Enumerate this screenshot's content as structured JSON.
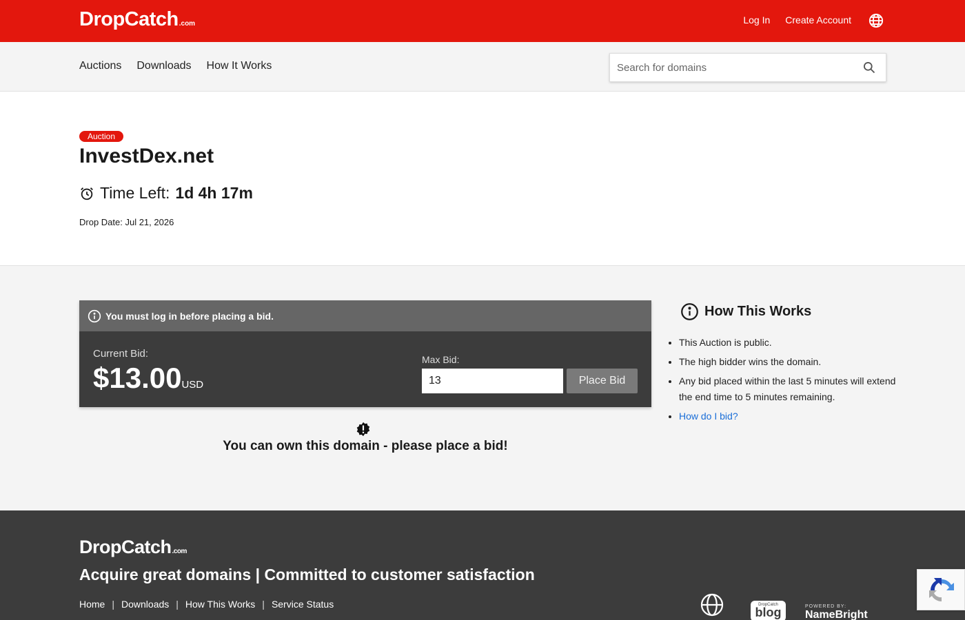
{
  "header": {
    "logo_text": "DropCatch",
    "logo_suffix": ".com",
    "login_label": "Log In",
    "create_account_label": "Create Account",
    "brand_color": "#e3170d"
  },
  "nav": {
    "items": [
      {
        "label": "Auctions"
      },
      {
        "label": "Downloads"
      },
      {
        "label": "How It Works"
      }
    ],
    "search_placeholder": "Search for domains"
  },
  "domain": {
    "badge": "Auction",
    "name": "InvestDex.net",
    "time_left_label": "Time Left:",
    "time_left_value": "1d 4h 17m",
    "drop_date": "Drop Date: Jul 21, 2026"
  },
  "bid": {
    "alert": "You must log in before placing a bid.",
    "current_bid_label": "Current Bid:",
    "current_bid_value": "$13.00",
    "currency": "USD",
    "max_bid_label": "Max Bid:",
    "max_bid_value": "13",
    "place_bid_label": "Place Bid",
    "cta": "You can own this domain - please place a bid!"
  },
  "how_it_works": {
    "title": "How This Works",
    "items": [
      "This Auction is public.",
      "The high bidder wins the domain.",
      "Any bid placed within the last 5 minutes will extend the end time to 5 minutes remaining."
    ],
    "link_label": "How do I bid?"
  },
  "footer": {
    "logo_text": "DropCatch",
    "logo_suffix": ".com",
    "tagline": "Acquire great domains | Committed to customer satisfaction",
    "links": [
      "Home",
      "Downloads",
      "How This Works",
      "Service Status"
    ],
    "blog_small": "DropCatch",
    "blog_big": "blog",
    "powered_by": "POWERED BY:",
    "namebright": "NameBright"
  }
}
